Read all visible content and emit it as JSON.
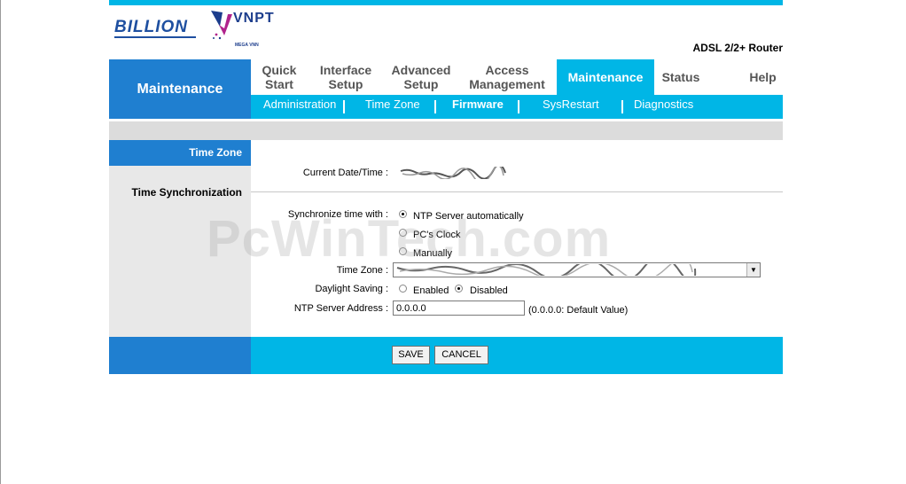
{
  "header": {
    "logo_billion": "BILLION",
    "logo_vnpt": "VNPT",
    "logo_vnpt_sub": "MEGA VNN",
    "product_name": "ADSL 2/2+ Router"
  },
  "nav": {
    "section_title": "Maintenance",
    "tabs": [
      {
        "label": "Quick\nStart"
      },
      {
        "label": "Interface\nSetup"
      },
      {
        "label": "Advanced\nSetup"
      },
      {
        "label": "Access\nManagement"
      },
      {
        "label": "Maintenance",
        "active": true
      },
      {
        "label": "Status"
      },
      {
        "label": "Help"
      }
    ],
    "subtabs": [
      "Administration",
      "Time Zone",
      "Firmware",
      "SysRestart",
      "Diagnostics"
    ],
    "subtab_current": "Firmware"
  },
  "sidebar": {
    "active_item": "Time Zone",
    "section_label": "Time Synchronization"
  },
  "form": {
    "current_datetime_label": "Current Date/Time :",
    "sync_label": "Synchronize time with :",
    "sync_options": [
      "NTP Server automatically",
      "PC's Clock",
      "Manually"
    ],
    "sync_selected": "NTP Server automatically",
    "timezone_label": "Time Zone :",
    "daylight_label": "Daylight Saving :",
    "daylight_options": [
      "Enabled",
      "Disabled"
    ],
    "daylight_selected": "Disabled",
    "ntp_label": "NTP Server Address :",
    "ntp_value": "0.0.0.0",
    "ntp_hint": "(0.0.0.0: Default Value)"
  },
  "actions": {
    "save_label": "SAVE",
    "cancel_label": "CANCEL"
  },
  "watermark": "PcWinTech.com",
  "colors": {
    "dark_blue": "#1f7fd0",
    "cyan": "#00b6e6",
    "gray_bar": "#dcdcdc"
  }
}
